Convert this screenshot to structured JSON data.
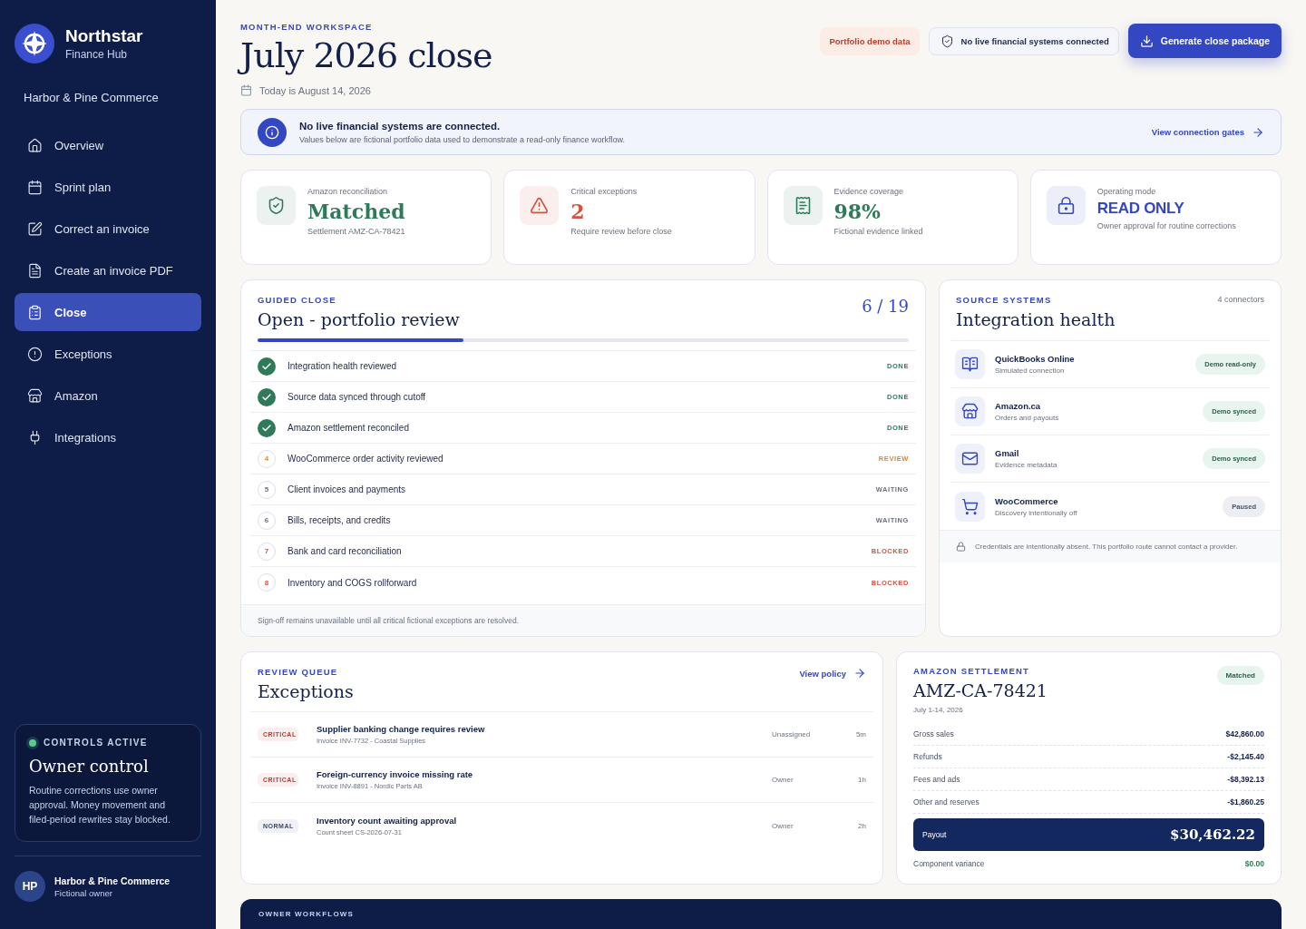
{
  "sidebar": {
    "brand": {
      "name": "Northstar",
      "subtitle": "Finance Hub"
    },
    "company": "Harbor & Pine Commerce",
    "nav": [
      {
        "label": "Overview",
        "selected": false
      },
      {
        "label": "Sprint plan",
        "selected": false
      },
      {
        "label": "Correct an invoice",
        "selected": false
      },
      {
        "label": "Create an invoice PDF",
        "selected": false
      },
      {
        "label": "Close",
        "selected": true
      },
      {
        "label": "Exceptions",
        "selected": false
      },
      {
        "label": "Amazon",
        "selected": false
      },
      {
        "label": "Integrations",
        "selected": false
      }
    ],
    "controls": {
      "eyebrow": "CONTROLS ACTIVE",
      "active": true,
      "title": "Owner control",
      "text": "Routine corrections use owner approval. Money movement and filed-period rewrites stay blocked."
    },
    "user": {
      "initials": "HP",
      "name": "Harbor & Pine Commerce",
      "role": "Fictional owner"
    }
  },
  "header": {
    "eyebrow": "MONTH-END WORKSPACE",
    "title": "July 2026 close",
    "date": "Today is August 14, 2026",
    "demo_badge": "Portfolio demo data",
    "status_badge": "No live financial systems connected",
    "primary_button": "Generate close package"
  },
  "banner": {
    "title": "No live financial systems are connected.",
    "text": "Values below are fictional portfolio data used to demonstrate a read-only finance workflow.",
    "link": "View connection gates"
  },
  "metrics": [
    {
      "label": "Amazon reconciliation",
      "value": "Matched",
      "note": "Settlement AMZ-CA-78421",
      "color": "#2f7a58"
    },
    {
      "label": "Critical exceptions",
      "value": "2",
      "note": "Require review before close",
      "color": "#d2543f"
    },
    {
      "label": "Evidence coverage",
      "value": "98%",
      "note": "Fictional evidence linked",
      "color": "#2f7a58"
    },
    {
      "label": "Operating mode",
      "value": "READ ONLY",
      "note": "Owner approval for routine corrections",
      "color": "#3447c2"
    }
  ],
  "guided_close": {
    "eyebrow": "GUIDED CLOSE",
    "title": "Open - portfolio review",
    "count": "6 / 19",
    "level": 0.316,
    "steps": [
      {
        "label": "Integration health reviewed",
        "kind": "done",
        "status": "DONE"
      },
      {
        "label": "Source data synced through cutoff",
        "kind": "done",
        "status": "DONE"
      },
      {
        "label": "Amazon settlement reconciled",
        "kind": "done",
        "status": "DONE"
      },
      {
        "number": "4",
        "label": "WooCommerce order activity reviewed",
        "kind": "review",
        "status": "REVIEW"
      },
      {
        "number": "5",
        "label": "Client invoices and payments",
        "kind": "waiting",
        "status": "WAITING"
      },
      {
        "number": "6",
        "label": "Bills, receipts, and credits",
        "kind": "waiting",
        "status": "WAITING"
      },
      {
        "number": "7",
        "label": "Bank and card reconciliation",
        "kind": "blocked",
        "status": "BLOCKED"
      },
      {
        "number": "8",
        "label": "Inventory and COGS rollforward",
        "kind": "blocked",
        "status": "BLOCKED"
      }
    ],
    "footer": "Sign-off remains unavailable until all critical fictional exceptions are resolved."
  },
  "integrations": {
    "eyebrow": "SOURCE SYSTEMS",
    "title": "Integration health",
    "count": "4 connectors",
    "connectors": [
      {
        "name": "QuickBooks Online",
        "detail": "Simulated connection",
        "status": "Demo read-only",
        "paused": false
      },
      {
        "name": "Amazon.ca",
        "detail": "Orders and payouts",
        "status": "Demo synced",
        "paused": false
      },
      {
        "name": "Gmail",
        "detail": "Evidence metadata",
        "status": "Demo synced",
        "paused": false
      },
      {
        "name": "WooCommerce",
        "detail": "Discovery intentionally off",
        "status": "Paused",
        "paused": true
      }
    ],
    "footer": "Credentials are intentionally absent. This portfolio route cannot contact a provider."
  },
  "exceptions": {
    "eyebrow": "REVIEW QUEUE",
    "title": "Exceptions",
    "link": "View policy",
    "rows": [
      {
        "severity": "CRITICAL",
        "color": "#c0392b",
        "title": "Supplier banking change requires review",
        "detail": "Invoice INV-7732 - Coastal Supplies",
        "owner": "Unassigned",
        "age": "5m"
      },
      {
        "severity": "CRITICAL",
        "color": "#c0392b",
        "title": "Foreign-currency invoice missing rate",
        "detail": "Invoice INV-8891 - Nordic Parts AB",
        "owner": "Owner",
        "age": "1h"
      },
      {
        "severity": "NORMAL",
        "color": "#3d4a6b",
        "title": "Inventory count awaiting approval",
        "detail": "Count sheet CS-2026-07-31",
        "owner": "Owner",
        "age": "2h"
      }
    ]
  },
  "settlement": {
    "eyebrow": "AMAZON SETTLEMENT",
    "title": "AMZ-CA-78421",
    "period": "July 1-14, 2026",
    "badge": "Matched",
    "lines": [
      {
        "label": "Gross sales",
        "value": "$42,860.00"
      },
      {
        "label": "Refunds",
        "value": "-$2,145.40"
      },
      {
        "label": "Fees and ads",
        "value": "-$8,392.13"
      },
      {
        "label": "Other and reserves",
        "value": "-$1,860.25"
      }
    ],
    "payout": {
      "label": "Payout",
      "value": "$30,462.22"
    },
    "variance": {
      "label": "Component variance",
      "value": "$0.00"
    }
  },
  "workflows": {
    "eyebrow": "OWNER WORKFLOWS"
  }
}
